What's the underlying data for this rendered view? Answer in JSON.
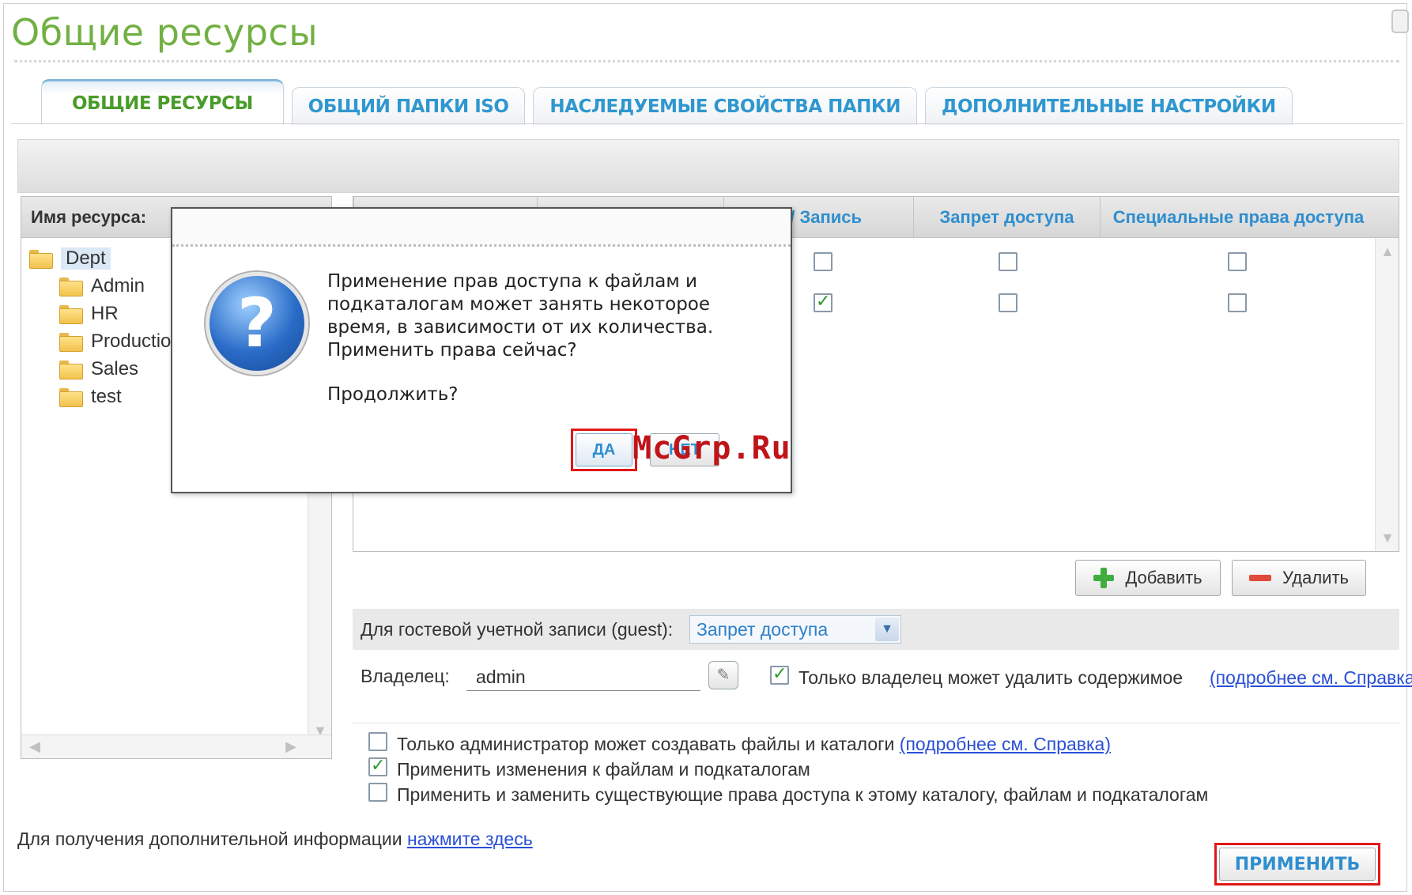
{
  "page": {
    "title": "Общие ресурсы"
  },
  "tabs": [
    {
      "label": "ОБЩИЕ РЕСУРСЫ",
      "active": true
    },
    {
      "label": "ОБЩИЙ ПАПКИ ISO",
      "active": false
    },
    {
      "label": "НАСЛЕДУЕМЫЕ СВОЙСТВА ПАПКИ",
      "active": false
    },
    {
      "label": "ДОПОЛНИТЕЛЬНЫЕ НАСТРОЙКИ",
      "active": false
    }
  ],
  "tree": {
    "header": "Имя ресурса:",
    "root": "Dept",
    "children": [
      "Admin",
      "HR",
      "Productio",
      "Sales",
      "test"
    ]
  },
  "grid": {
    "columns": [
      "е / Запись",
      "Запрет доступа",
      "Специальные права доступа"
    ],
    "rows": [
      {
        "read_write": false,
        "deny": false,
        "special": false
      },
      {
        "read_write": true,
        "deny": false,
        "special": false
      }
    ],
    "add_label": "Добавить",
    "delete_label": "Удалить"
  },
  "guest": {
    "label": "Для гостевой учетной записи (guest):",
    "value": "Запрет доступа"
  },
  "owner": {
    "label": "Владелец:",
    "value": "admin",
    "only_owner_delete_label": "Только владелец может удалить содержимое",
    "only_owner_delete_checked": true,
    "help_link": "(подробнее см. Справка)"
  },
  "options": [
    {
      "label": "Только администратор может создавать файлы и каталоги",
      "checked": false,
      "link": "(подробнее см. Справка)"
    },
    {
      "label": "Применить изменения к файлам и подкаталогам",
      "checked": true,
      "link": ""
    },
    {
      "label": "Применить и заменить существующие права доступа к этому каталогу, файлам и подкаталогам",
      "checked": false,
      "link": ""
    }
  ],
  "footer": {
    "info_text": "Для получения дополнительной информации",
    "info_link": "нажмите здесь",
    "apply_label": "ПРИМЕНИТЬ"
  },
  "dialog": {
    "message": "Применение прав доступа к файлам и подкаталогам может занять некоторое время, в зависимости от их количества. Применить права сейчас?",
    "question": "Продолжить?",
    "yes_label": "ДА",
    "no_label": "НЕТ"
  },
  "watermark": "McGrp.Ru",
  "colors": {
    "title_green": "#72b043",
    "tab_blue": "#2f8ecf",
    "link_blue": "#2a4fd6",
    "highlight_red": "#e01818"
  },
  "icons": [
    "folder-icon",
    "question-icon",
    "plus-icon",
    "minus-icon",
    "edit-icon",
    "dropdown-arrow-icon"
  ]
}
